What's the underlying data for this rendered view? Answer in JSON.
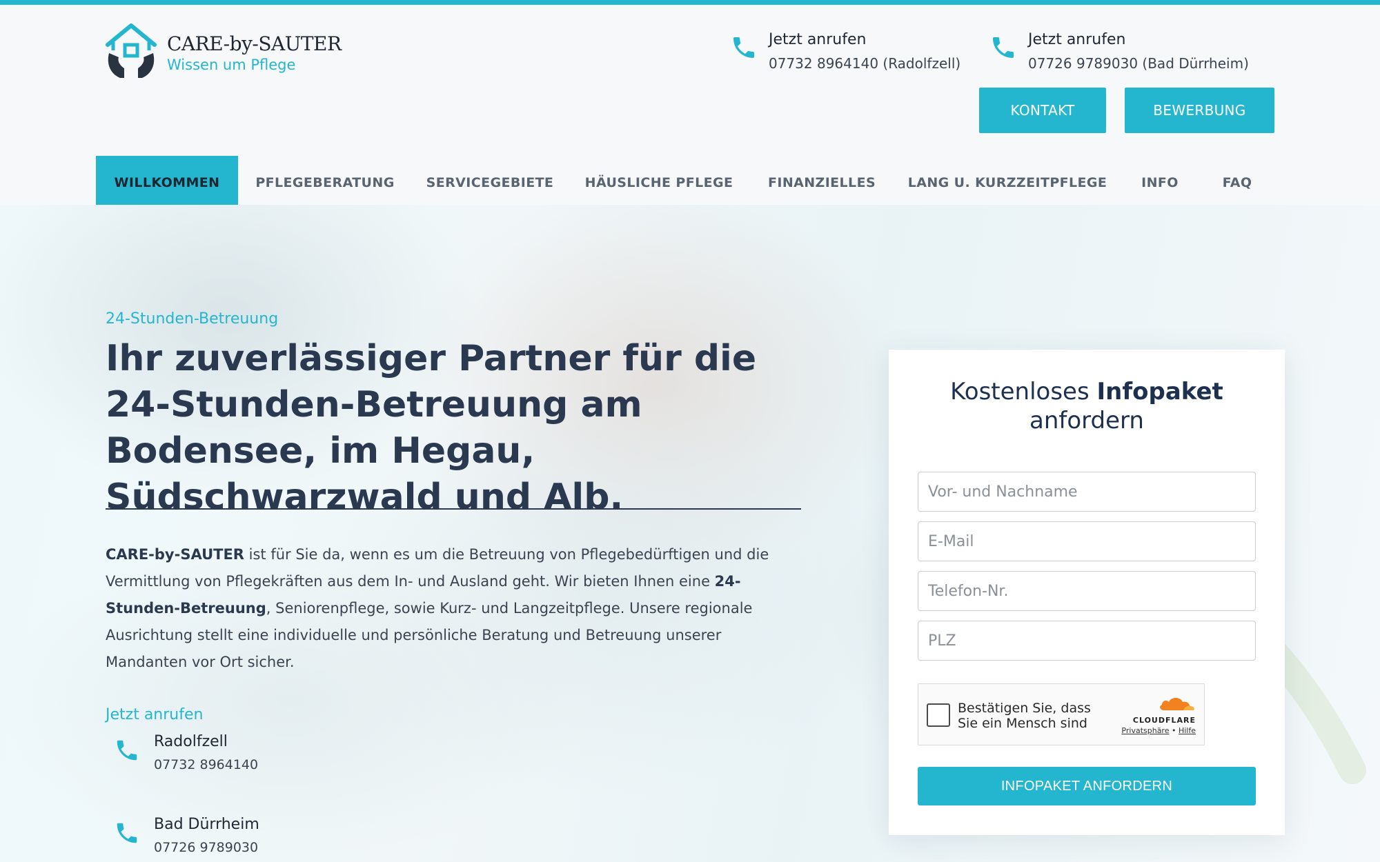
{
  "brand": {
    "name": "CARE-by-SAUTER",
    "tagline": "Wissen um Pflege",
    "accent_color": "#24b6cf",
    "heading_color": "#2b3950"
  },
  "header": {
    "contacts": [
      {
        "title": "Jetzt anrufen",
        "number": "07732 8964140 (Radolfzell)",
        "icon": "phone-icon"
      },
      {
        "title": "Jetzt anrufen",
        "number": "07726 9789030 (Bad Dürrheim)",
        "icon": "phone-icon"
      }
    ],
    "buttons": {
      "kontakt": "KONTAKT",
      "bewerbung": "BEWERBUNG"
    }
  },
  "nav": {
    "items": [
      {
        "label": "WILLKOMMEN",
        "active": true
      },
      {
        "label": "PFLEGEBERATUNG"
      },
      {
        "label": "SERVICEGEBIETE"
      },
      {
        "label": "HÄUSLICHE PFLEGE"
      },
      {
        "label": "FINANZIELLES"
      },
      {
        "label": "LANG U. KURZZEITPFLEGE"
      },
      {
        "label": "INFO"
      },
      {
        "label": "FAQ"
      }
    ]
  },
  "hero": {
    "kicker": "24-Stunden-Betreuung",
    "headline": "Ihr zuverlässiger Partner für die 24-Stunden-Betreuung am Bodensee, im Hegau, Südschwarzwald und Alb.",
    "intro": {
      "brand": "CARE-by-SAUTER",
      "part1": " ist für Sie da, wenn es um die Betreuung von Pflegebedürftigen und die Vermittlung von Pflegekräften aus dem In- und Ausland geht. Wir bieten Ihnen eine ",
      "bold": "24-Stunden-Betreuung",
      "part2": ", Seniorenpflege, sowie Kurz- und Langzeitpflege. Unsere regionale Ausrichtung stellt eine individuelle und persönliche Beratung und Betreuung unserer Mandanten vor Ort sicher."
    },
    "call_label": "Jetzt anrufen",
    "locations": [
      {
        "name": "Radolfzell",
        "number": "07732 8964140"
      },
      {
        "name": "Bad Dürrheim",
        "number": "07726 9789030"
      }
    ]
  },
  "form": {
    "title_part1": "Kostenloses ",
    "title_bold": "Infopaket",
    "title_part2": "anfordern",
    "fields": {
      "name_placeholder": "Vor- und Nachname",
      "email_placeholder": "E-Mail",
      "phone_placeholder": "Telefon-Nr.",
      "zip_placeholder": "PLZ"
    },
    "captcha": {
      "text_line1": "Bestätigen Sie, dass",
      "text_line2": "Sie ein Mensch sind",
      "provider": "CLOUDFLARE",
      "privacy": "Privatsphäre",
      "help": "Hilfe",
      "separator": " • "
    },
    "submit": "INFOPAKET ANFORDERN"
  }
}
